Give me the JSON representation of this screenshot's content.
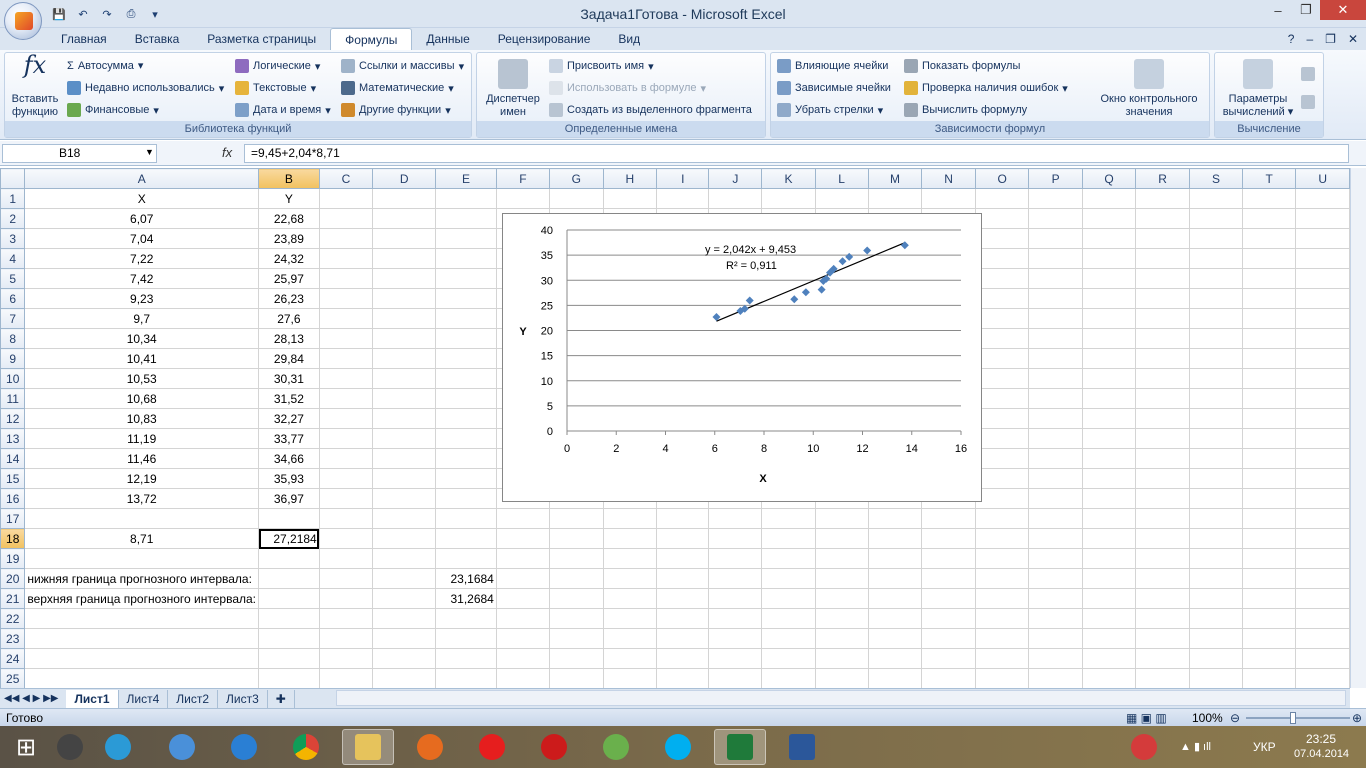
{
  "window": {
    "title": "Задача1Готова - Microsoft Excel",
    "controls": [
      "–",
      "❐",
      "✕"
    ]
  },
  "ribbon_tabs": [
    "Главная",
    "Вставка",
    "Разметка страницы",
    "Формулы",
    "Данные",
    "Рецензирование",
    "Вид"
  ],
  "active_tab": "Формулы",
  "ribbon": {
    "insert_function": "Вставить функцию",
    "autosum": "Автосумма",
    "recent": "Недавно использовались",
    "financial": "Финансовые",
    "logical": "Логические",
    "text": "Текстовые",
    "datetime": "Дата и время",
    "lookup": "Ссылки и массивы",
    "math": "Математические",
    "other": "Другие функции",
    "group_library": "Библиотека функций",
    "name_manager": "Диспетчер имен",
    "define_name": "Присвоить имя",
    "use_in_formula": "Использовать в формуле",
    "create_from_selection": "Создать из выделенного фрагмента",
    "group_names": "Определенные имена",
    "trace_precedents": "Влияющие ячейки",
    "trace_dependents": "Зависимые ячейки",
    "remove_arrows": "Убрать стрелки",
    "show_formulas": "Показать формулы",
    "error_checking": "Проверка наличия ошибок",
    "evaluate_formula": "Вычислить формулу",
    "watch_window": "Окно контрольного значения",
    "group_audit": "Зависимости формул",
    "calc_options": "Параметры вычислений",
    "group_calc": "Вычисление"
  },
  "formula_bar": {
    "name_box": "B18",
    "fx": "fx",
    "formula": "=9,45+2,04*8,71"
  },
  "columns": [
    "A",
    "B",
    "C",
    "D",
    "E",
    "F",
    "G",
    "H",
    "I",
    "J",
    "K",
    "L",
    "M",
    "N",
    "O",
    "P",
    "Q",
    "R",
    "S",
    "T",
    "U"
  ],
  "rows": [
    {
      "n": "1",
      "a": "X",
      "b": "Y"
    },
    {
      "n": "2",
      "a": "6,07",
      "b": "22,68"
    },
    {
      "n": "3",
      "a": "7,04",
      "b": "23,89"
    },
    {
      "n": "4",
      "a": "7,22",
      "b": "24,32"
    },
    {
      "n": "5",
      "a": "7,42",
      "b": "25,97"
    },
    {
      "n": "6",
      "a": "9,23",
      "b": "26,23"
    },
    {
      "n": "7",
      "a": "9,7",
      "b": "27,6"
    },
    {
      "n": "8",
      "a": "10,34",
      "b": "28,13"
    },
    {
      "n": "9",
      "a": "10,41",
      "b": "29,84"
    },
    {
      "n": "10",
      "a": "10,53",
      "b": "30,31"
    },
    {
      "n": "11",
      "a": "10,68",
      "b": "31,52"
    },
    {
      "n": "12",
      "a": "10,83",
      "b": "32,27"
    },
    {
      "n": "13",
      "a": "11,19",
      "b": "33,77"
    },
    {
      "n": "14",
      "a": "11,46",
      "b": "34,66"
    },
    {
      "n": "15",
      "a": "12,19",
      "b": "35,93"
    },
    {
      "n": "16",
      "a": "13,72",
      "b": "36,97"
    },
    {
      "n": "17",
      "a": "",
      "b": ""
    },
    {
      "n": "18",
      "a": "8,71",
      "b": "27,2184"
    },
    {
      "n": "19",
      "a": "",
      "b": ""
    },
    {
      "n": "20",
      "a": "нижняя граница прогнозного интервала:",
      "b": "",
      "e": "23,1684"
    },
    {
      "n": "21",
      "a": "верхняя граница прогнозного интервала:",
      "b": "",
      "e": "31,2684"
    },
    {
      "n": "22",
      "a": "",
      "b": ""
    },
    {
      "n": "23",
      "a": "",
      "b": ""
    },
    {
      "n": "24",
      "a": "",
      "b": ""
    },
    {
      "n": "25",
      "a": "",
      "b": ""
    }
  ],
  "sheet_tabs": [
    "Лист1",
    "Лист4",
    "Лист2",
    "Лист3"
  ],
  "active_sheet": "Лист1",
  "status": {
    "ready": "Готово",
    "zoom": "100%"
  },
  "taskbar": {
    "lang": "УКР",
    "time": "23:25",
    "date": "07.04.2014"
  },
  "chart_data": {
    "type": "scatter",
    "xlabel": "X",
    "ylabel": "Y",
    "xlim": [
      0,
      16
    ],
    "ylim": [
      0,
      40
    ],
    "xticks": [
      0,
      2,
      4,
      6,
      8,
      10,
      12,
      14,
      16
    ],
    "yticks": [
      0,
      5,
      10,
      15,
      20,
      25,
      30,
      35,
      40
    ],
    "x": [
      6.07,
      7.04,
      7.22,
      7.42,
      9.23,
      9.7,
      10.34,
      10.41,
      10.53,
      10.68,
      10.83,
      11.19,
      11.46,
      12.19,
      13.72
    ],
    "y": [
      22.68,
      23.89,
      24.32,
      25.97,
      26.23,
      27.6,
      28.13,
      29.84,
      30.31,
      31.52,
      32.27,
      33.77,
      34.66,
      35.93,
      36.97
    ],
    "trendline": {
      "slope": 2.042,
      "intercept": 9.453,
      "x_range": [
        6.07,
        13.72
      ]
    },
    "equation": "y = 2,042x + 9,453",
    "r2": "R² = 0,911",
    "grid": true,
    "marker_color": "#4f81bd"
  }
}
